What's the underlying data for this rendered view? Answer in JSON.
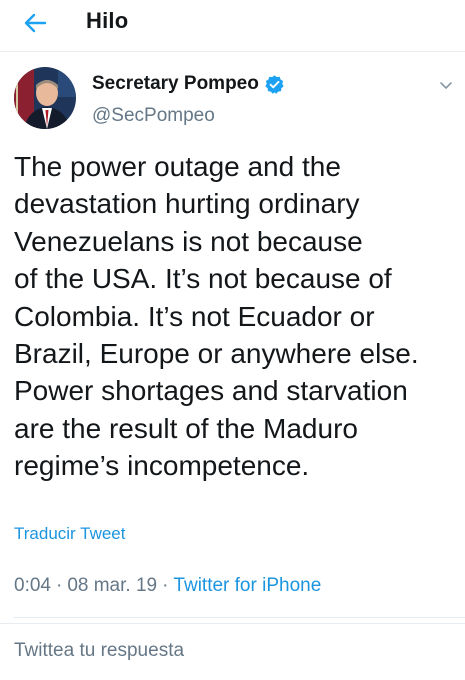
{
  "header": {
    "title": "Hilo",
    "back_icon": "arrow-left-icon"
  },
  "author": {
    "display_name": "Secretary Pompeo",
    "handle": "@SecPompeo",
    "verified_icon": "verified-badge-icon"
  },
  "tweet": {
    "text": "The power outage and the\ndevastation hurting ordinary\nVenezuelans is not because\nof the USA. It’s not because of\nColombia.  It’s not Ecuador or\nBrazil, Europe or anywhere else.\nPower shortages and starvation\nare the result of the Maduro\nregime’s incompetence.",
    "translate_label": "Traducir Tweet",
    "time": "0:04",
    "date": "08 mar. 19",
    "separator": "·",
    "source": "Twitter for iPhone"
  },
  "reply": {
    "placeholder": "Twittea tu respuesta"
  },
  "colors": {
    "accent": "#1da1f2",
    "link": "#1b95e0",
    "muted": "#657786",
    "text": "#14171a"
  }
}
